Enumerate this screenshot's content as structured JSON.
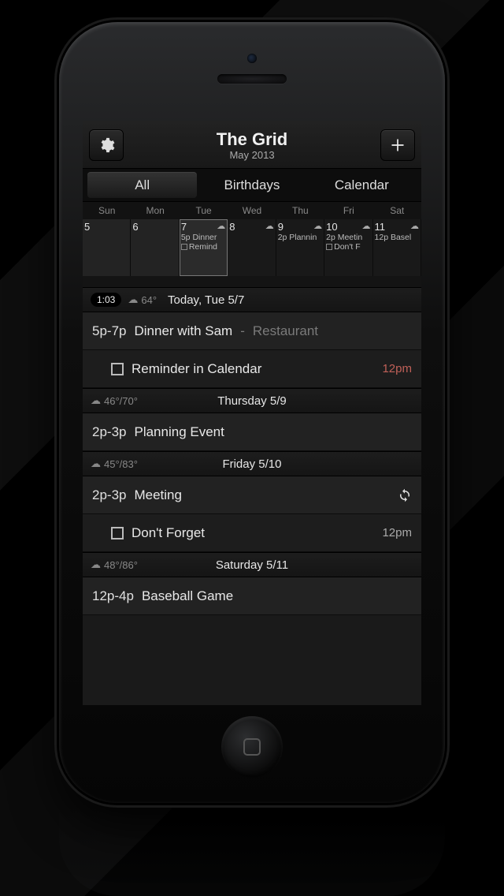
{
  "header": {
    "title": "The Grid",
    "subtitle": "May 2013"
  },
  "tabs": [
    {
      "label": "All",
      "active": true
    },
    {
      "label": "Birthdays",
      "active": false
    },
    {
      "label": "Calendar",
      "active": false
    }
  ],
  "weekdays": [
    "Sun",
    "Mon",
    "Tue",
    "Wed",
    "Thu",
    "Fri",
    "Sat"
  ],
  "week": [
    {
      "num": "5",
      "dim": true
    },
    {
      "num": "6",
      "dim": true
    },
    {
      "num": "7",
      "selected": true,
      "weather": true,
      "events": [
        "5p Dinner"
      ],
      "reminders": [
        "Remind"
      ]
    },
    {
      "num": "8",
      "weather": true
    },
    {
      "num": "9",
      "weather": true,
      "events": [
        "2p Plannin"
      ]
    },
    {
      "num": "10",
      "weather": true,
      "events": [
        "2p Meetin"
      ],
      "reminders": [
        "Don't F"
      ]
    },
    {
      "num": "11",
      "weather": true,
      "events": [
        "12p Basel"
      ]
    }
  ],
  "sections": [
    {
      "clock": "1:03",
      "weather_icon": true,
      "temp": "64°",
      "title": "Today, Tue 5/7",
      "rows": [
        {
          "type": "event",
          "time": "5p-7p",
          "title": "Dinner with Sam",
          "loc": "Restaurant"
        },
        {
          "type": "reminder",
          "title": "Reminder in Calendar",
          "right": "12pm",
          "accent": true
        }
      ]
    },
    {
      "weather_icon": true,
      "temp": "46°/70°",
      "title": "Thursday 5/9",
      "rows": [
        {
          "type": "event",
          "time": "2p-3p",
          "title": "Planning Event"
        }
      ]
    },
    {
      "weather_icon": true,
      "temp": "45°/83°",
      "title": "Friday 5/10",
      "rows": [
        {
          "type": "event",
          "time": "2p-3p",
          "title": "Meeting",
          "repeat": true
        },
        {
          "type": "reminder",
          "title": "Don't Forget",
          "right": "12pm"
        }
      ]
    },
    {
      "weather_icon": true,
      "temp": "48°/86°",
      "title": "Saturday 5/11",
      "rows": [
        {
          "type": "event",
          "time": "12p-4p",
          "title": "Baseball Game"
        }
      ]
    }
  ]
}
